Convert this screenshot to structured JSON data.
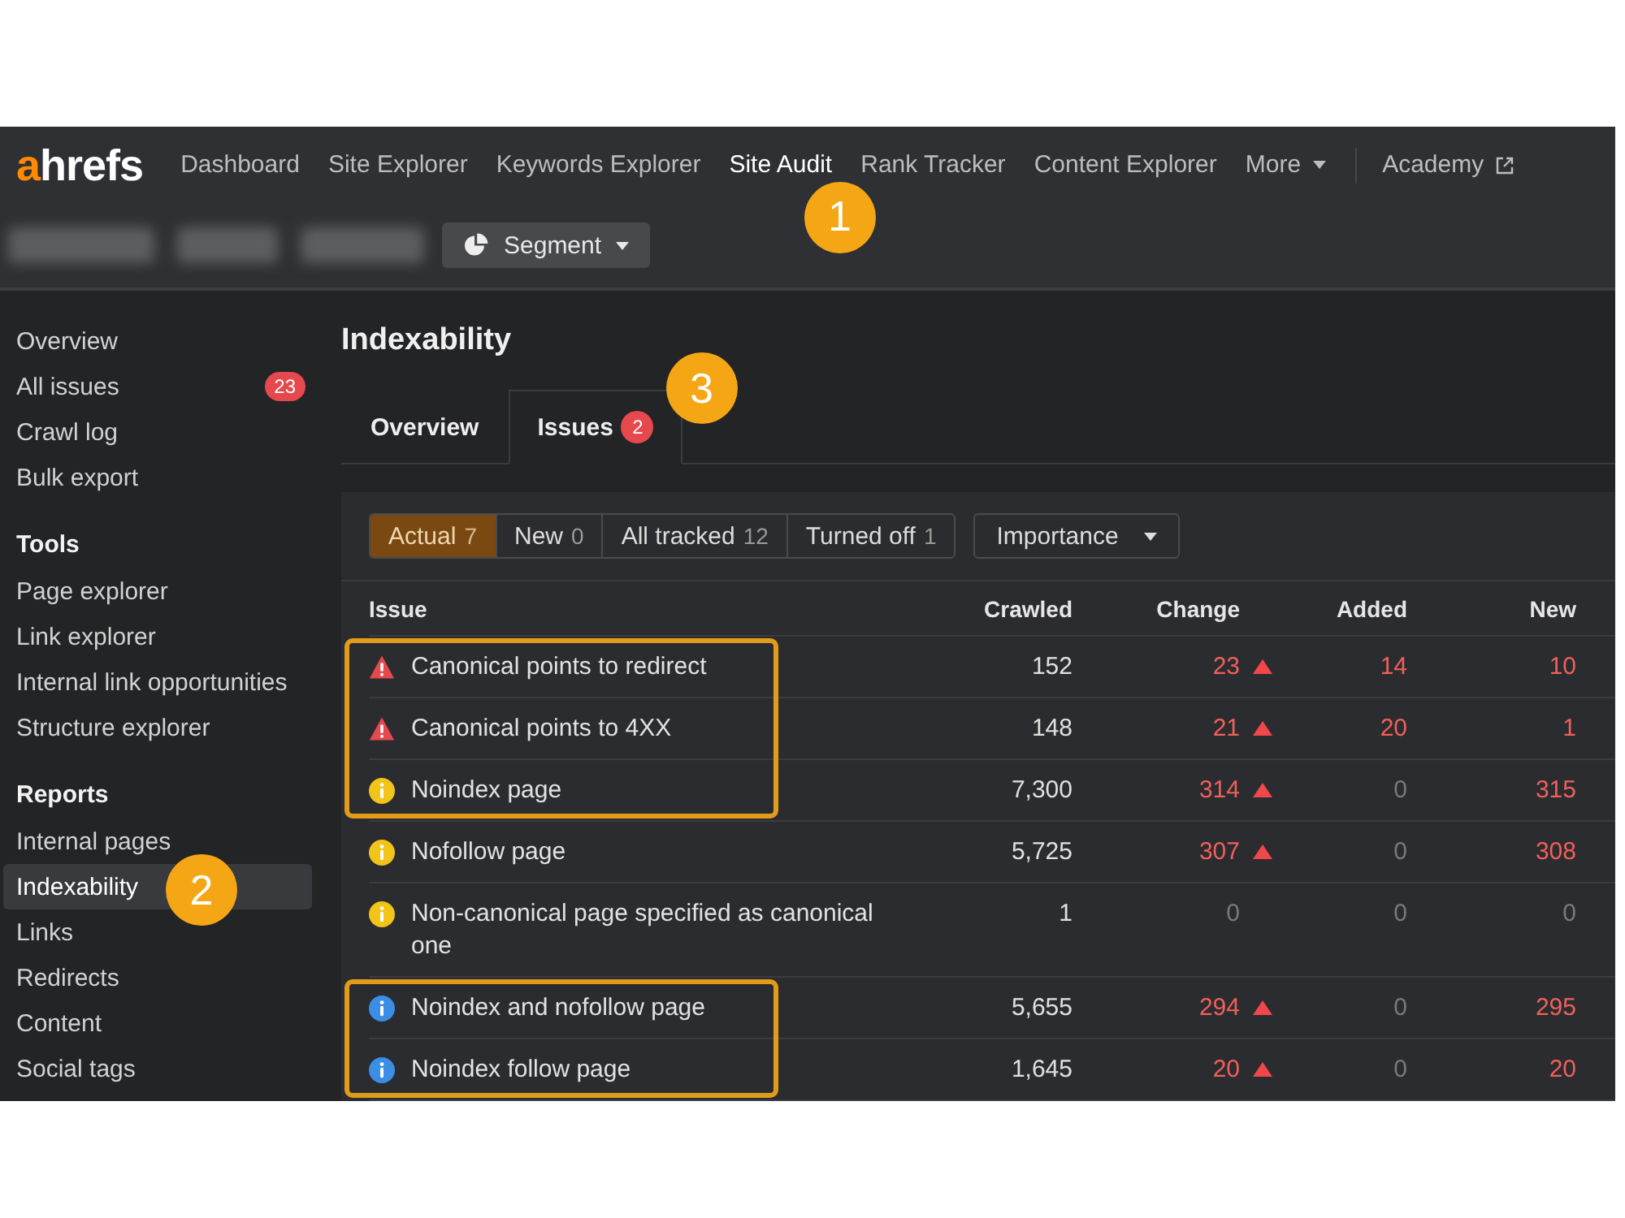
{
  "nav": {
    "logo": {
      "accent": "a",
      "text": "hrefs"
    },
    "items": [
      {
        "label": "Dashboard",
        "kind": "link",
        "selected": false
      },
      {
        "label": "Site Explorer",
        "kind": "link",
        "selected": false
      },
      {
        "label": "Keywords Explorer",
        "kind": "link",
        "selected": false
      },
      {
        "label": "Site Audit",
        "kind": "link",
        "selected": true,
        "marker": "1"
      },
      {
        "label": "Rank Tracker",
        "kind": "link",
        "selected": false
      },
      {
        "label": "Content Explorer",
        "kind": "link",
        "selected": false
      },
      {
        "label": "More",
        "kind": "menu",
        "selected": false
      }
    ],
    "external_links": [
      {
        "label": "Academy"
      }
    ]
  },
  "toolbar": {
    "segment_button": {
      "label": "Segment"
    }
  },
  "sidebar": {
    "groups": [
      {
        "items": [
          {
            "label": "Overview",
            "selected": false
          },
          {
            "label": "All issues",
            "selected": false,
            "badge": "23"
          },
          {
            "label": "Crawl log",
            "selected": false
          },
          {
            "label": "Bulk export",
            "selected": false
          }
        ]
      },
      {
        "heading": "Tools",
        "items": [
          {
            "label": "Page explorer",
            "selected": false
          },
          {
            "label": "Link explorer",
            "selected": false
          },
          {
            "label": "Internal link opportunities",
            "selected": false
          },
          {
            "label": "Structure explorer",
            "selected": false
          }
        ]
      },
      {
        "heading": "Reports",
        "items": [
          {
            "label": "Internal pages",
            "selected": false
          },
          {
            "label": "Indexability",
            "selected": true,
            "marker": "2"
          },
          {
            "label": "Links",
            "selected": false
          },
          {
            "label": "Redirects",
            "selected": false
          },
          {
            "label": "Content",
            "selected": false
          },
          {
            "label": "Social tags",
            "selected": false
          }
        ]
      }
    ]
  },
  "page_title": "Indexability",
  "tabs": [
    {
      "label": "Overview",
      "selected": false
    },
    {
      "label": "Issues",
      "selected": true,
      "badge": "2",
      "marker": "3"
    }
  ],
  "filters": [
    {
      "label": "Actual",
      "count": "7",
      "selected": true
    },
    {
      "label": "New",
      "count": "0",
      "selected": false
    },
    {
      "label": "All tracked",
      "count": "12",
      "selected": false
    },
    {
      "label": "Turned off",
      "count": "1",
      "selected": false
    }
  ],
  "sort_dropdown": {
    "label": "Importance"
  },
  "table": {
    "columns": [
      "Issue",
      "Crawled",
      "Change",
      "Added",
      "New"
    ],
    "rows": [
      {
        "kind": "error",
        "issue": "Canonical points to redirect",
        "crawled": "152",
        "change": {
          "text": "23",
          "alert": true,
          "rising": true
        },
        "added": {
          "text": "14",
          "alert": true
        },
        "new": {
          "text": "10",
          "alert": true
        },
        "highlighted": true
      },
      {
        "kind": "error",
        "issue": "Canonical points to 4XX",
        "crawled": "148",
        "change": {
          "text": "21",
          "alert": true,
          "rising": true
        },
        "added": {
          "text": "20",
          "alert": true
        },
        "new": {
          "text": "1",
          "alert": true
        },
        "highlighted": true
      },
      {
        "kind": "warning",
        "issue": "Noindex page",
        "crawled": "7,300",
        "change": {
          "text": "314",
          "alert": true,
          "rising": true
        },
        "added": {
          "text": "0",
          "alert": false
        },
        "new": {
          "text": "315",
          "alert": true
        },
        "highlighted": true
      },
      {
        "kind": "warning",
        "issue": "Nofollow page",
        "crawled": "5,725",
        "change": {
          "text": "307",
          "alert": true,
          "rising": true
        },
        "added": {
          "text": "0",
          "alert": false
        },
        "new": {
          "text": "308",
          "alert": true
        },
        "highlighted": false
      },
      {
        "kind": "warning",
        "issue": "Non-canonical page specified as canonical one",
        "crawled": "1",
        "change": {
          "text": "0",
          "alert": false,
          "rising": false
        },
        "added": {
          "text": "0",
          "alert": false
        },
        "new": {
          "text": "0",
          "alert": false
        },
        "highlighted": false
      },
      {
        "kind": "notice",
        "issue": "Noindex and nofollow page",
        "crawled": "5,655",
        "change": {
          "text": "294",
          "alert": true,
          "rising": true
        },
        "added": {
          "text": "0",
          "alert": false
        },
        "new": {
          "text": "295",
          "alert": true
        },
        "highlighted": true
      },
      {
        "kind": "notice",
        "issue": "Noindex follow page",
        "crawled": "1,645",
        "change": {
          "text": "20",
          "alert": true,
          "rising": true
        },
        "added": {
          "text": "0",
          "alert": false
        },
        "new": {
          "text": "20",
          "alert": true
        },
        "highlighted": true
      }
    ]
  }
}
